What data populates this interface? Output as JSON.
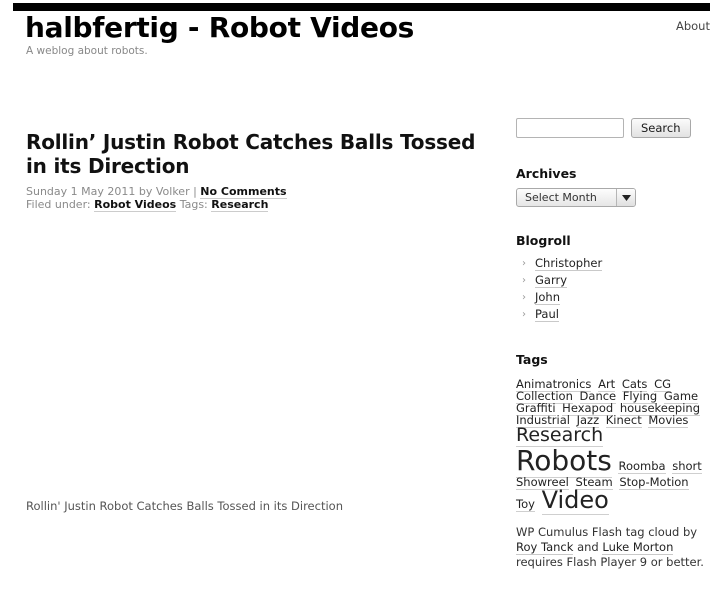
{
  "header": {
    "top_rule": "",
    "site_title": "halbfertig - Robot Videos",
    "site_description": "A weblog about robots.",
    "nav": [
      {
        "label": "About"
      }
    ]
  },
  "main": {
    "post": {
      "title": "Rollin’ Justin Robot Catches Balls Tossed in its Direction",
      "meta_date_prefix": "Sunday 1 May 2011 by Volker | ",
      "meta_comments": "No Comments",
      "meta_filed_prefix": "Filed under: ",
      "meta_category": "Robot Videos",
      "meta_tags_prefix": " Tags: ",
      "meta_tag": "Research",
      "caption": "Rollin' Justin Robot Catches Balls Tossed in its Direction"
    }
  },
  "sidebar": {
    "search": {
      "value": "",
      "placeholder": "",
      "button_label": "Search"
    },
    "archives": {
      "title": "Archives",
      "selected": "Select Month"
    },
    "blogroll": {
      "title": "Blogroll",
      "bullet": "›",
      "items": [
        {
          "label": "Christopher"
        },
        {
          "label": "Garry"
        },
        {
          "label": "John"
        },
        {
          "label": "Paul"
        }
      ]
    },
    "tags": {
      "title": "Tags",
      "items": [
        {
          "label": "Animatronics",
          "size": 11.5
        },
        {
          "label": "Art",
          "size": 11.5
        },
        {
          "label": "Cats",
          "size": 11.5
        },
        {
          "label": "CG",
          "size": 11.5
        },
        {
          "label": "Collection",
          "size": 11.5
        },
        {
          "label": "Dance",
          "size": 11.5
        },
        {
          "label": "Flying",
          "size": 11.5
        },
        {
          "label": "Game",
          "size": 11.5
        },
        {
          "label": "Graffiti",
          "size": 11.5
        },
        {
          "label": "Hexapod",
          "size": 11.5
        },
        {
          "label": "housekeeping",
          "size": 11.5
        },
        {
          "label": "Industrial",
          "size": 11.5
        },
        {
          "label": "Jazz",
          "size": 11.5
        },
        {
          "label": "Kinect",
          "size": 11.5
        },
        {
          "label": "Movies",
          "size": 11.5
        },
        {
          "label": "Research",
          "size": 19
        },
        {
          "label": "Robots",
          "size": 28
        },
        {
          "label": "Roomba",
          "size": 11.5
        },
        {
          "label": "short",
          "size": 11.5
        },
        {
          "label": "Showreel",
          "size": 11.5
        },
        {
          "label": "Steam",
          "size": 11.5
        },
        {
          "label": "Stop-Motion",
          "size": 11.5
        },
        {
          "label": "Toy",
          "size": 11.5
        },
        {
          "label": "Video",
          "size": 24
        }
      ],
      "flash_note": {
        "prefix": "WP Cumulus Flash tag cloud by ",
        "author1": "Roy Tanck",
        "joiner": " and ",
        "author2": "Luke Morton",
        "suffix": " requires Flash Player 9 or better."
      }
    }
  },
  "colors": {
    "page_background": "#ffffff",
    "top_rule": "#000000",
    "text": "#333333",
    "muted_text": "#8a8a8a",
    "heading": "#111111",
    "link_underline": "#c9c9c9"
  }
}
